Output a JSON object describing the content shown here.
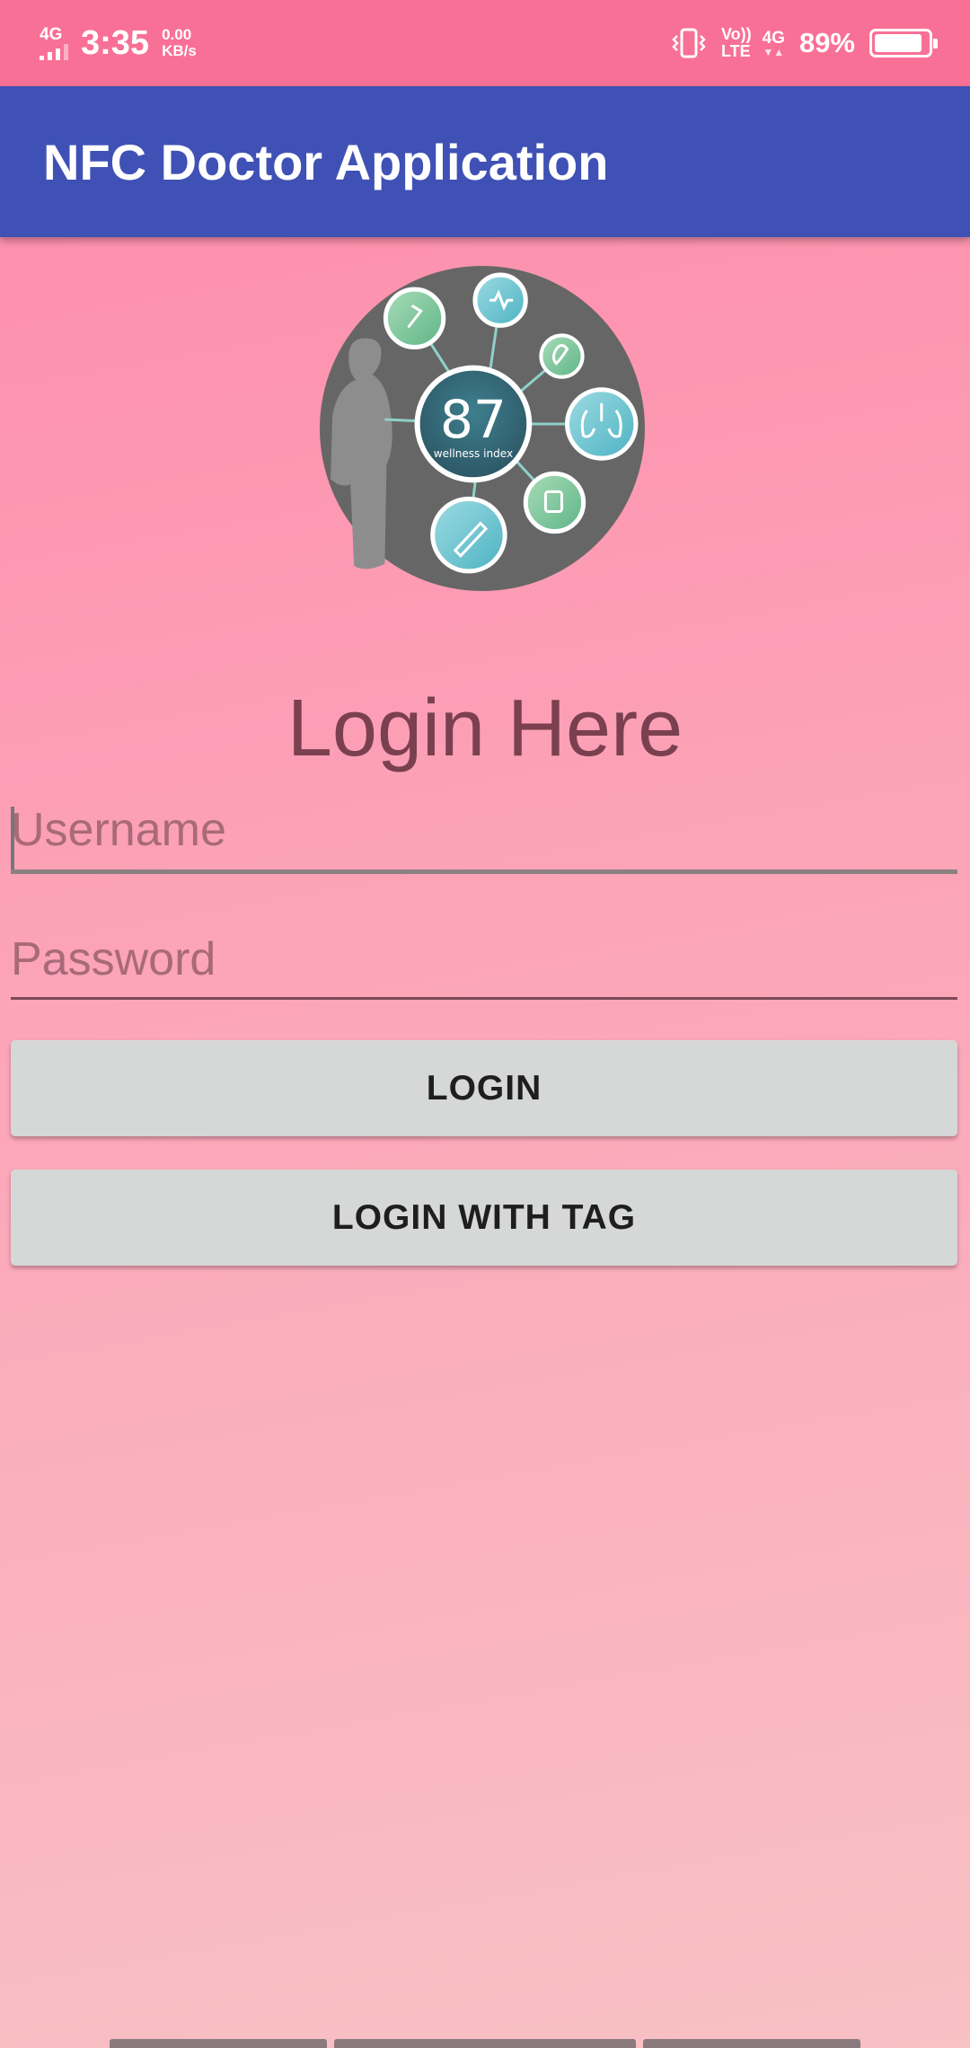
{
  "status_bar": {
    "network_left": "4G",
    "time": "3:35",
    "speed_value": "0.00",
    "speed_unit": "KB/s",
    "volte_top": "Vo))",
    "volte_bottom": "LTE",
    "network_right": "4G",
    "battery_percent": "89%",
    "battery_level": 0.89
  },
  "app_bar": {
    "title": "NFC Doctor Application"
  },
  "logo": {
    "score": "87",
    "caption": "wellness index"
  },
  "login": {
    "heading": "Login Here",
    "username_placeholder": "Username",
    "password_placeholder": "Password",
    "login_button": "LOGIN",
    "tag_button": "LOGIN WITH TAG"
  },
  "colors": {
    "status_bar": "#f97096",
    "app_bar": "#3f51b5",
    "button": "#d6d7d7",
    "heading": "#7b4050"
  }
}
